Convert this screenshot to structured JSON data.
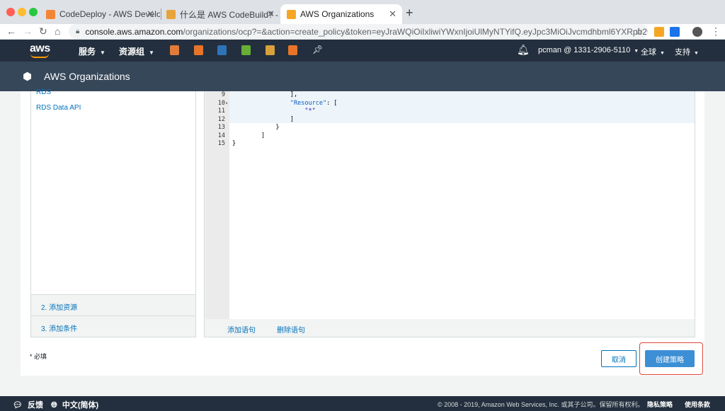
{
  "browser": {
    "tabs": [
      {
        "title": "CodeDeploy - AWS Developer",
        "active": false
      },
      {
        "title": "什么是 AWS CodeBuild?  - AWS",
        "active": false
      },
      {
        "title": "AWS Organizations",
        "active": true
      }
    ],
    "url_host": "console.aws.amazon.com",
    "url_path": "/organizations/ocp?=&action=create_policy&token=eyJraWQiOiIxliwiYWxnIjoiUlMyNTYifQ.eyJpc3MiOiJvcmdhbml6YXRpb25zIiwicmVxd..."
  },
  "aws_header": {
    "logo": "aws",
    "services_label": "服务",
    "resource_groups_label": "资源组",
    "account": "pcman @ 1331-2906-5110",
    "region": "全球",
    "support": "支持"
  },
  "service": {
    "title": "AWS Organizations"
  },
  "left_panel": {
    "items": [
      "RDS",
      "RDS Data API"
    ],
    "step2": "2. 添加资源",
    "step3": "3. 添加条件"
  },
  "editor": {
    "lines": [
      {
        "num": "9",
        "fold": false,
        "text": "                ],"
      },
      {
        "num": "10",
        "fold": true,
        "text": "                \"Resource\": ["
      },
      {
        "num": "11",
        "fold": false,
        "text": "                    \"*\""
      },
      {
        "num": "12",
        "fold": false,
        "text": "                ]"
      },
      {
        "num": "13",
        "fold": false,
        "text": "            }"
      },
      {
        "num": "14",
        "fold": false,
        "text": "        ]"
      },
      {
        "num": "15",
        "fold": false,
        "text": "}"
      }
    ],
    "add_statement": "添加语句",
    "remove_statement": "删除语句"
  },
  "form": {
    "required_note": "* 必填",
    "cancel": "取消",
    "create": "创建策略"
  },
  "footer": {
    "feedback": "反馈",
    "language": "中文(简体)",
    "copyright": "© 2008 - 2019, Amazon Web Services, Inc. 或其子公司。保留所有权利。",
    "privacy": "隐私策略",
    "terms": "使用条款"
  },
  "colors": {
    "aws_nav": "#232f3e",
    "aws_subheader": "#37475a",
    "aws_orange": "#ff9900",
    "link_blue": "#0073bb",
    "primary_button": "#3c8fd4",
    "highlight_box": "#e1453b"
  }
}
